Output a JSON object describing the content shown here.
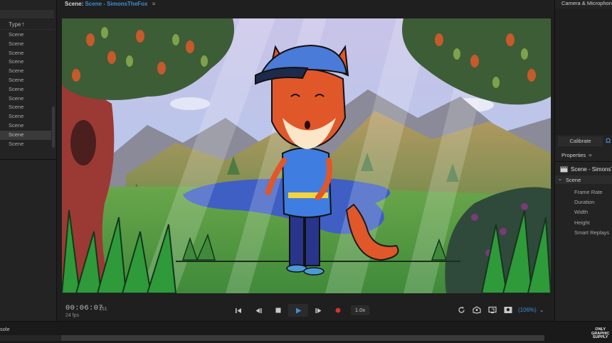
{
  "left_panel": {
    "type_header": "Type",
    "sort_icon": "sort-ascending-icon",
    "items": [
      "Scene",
      "Scene",
      "Scene",
      "Scene",
      "Scene",
      "Scene",
      "Scene",
      "Scene",
      "Scene",
      "Scene",
      "Scene",
      "Scene",
      "Scene"
    ],
    "selected_index": 11
  },
  "scene_panel": {
    "title_prefix": "Scene:",
    "scene_name": "Scene - SimonsTheFox",
    "menu_glyph": "≡",
    "timecode": "00:06:07",
    "frame": "151",
    "fps": "24 fps",
    "transport": {
      "icons": [
        "skip-to-start-icon",
        "step-back-icon",
        "stop-icon",
        "play-icon",
        "step-forward-icon",
        "record-icon"
      ]
    },
    "speed": "1.0x",
    "tools": [
      "refresh-icon",
      "fit-view-icon",
      "screen-icon",
      "scene-preview-icon"
    ],
    "zoom": "(106%)",
    "zoom_chevron": "⌄"
  },
  "right_panel": {
    "camera_title": "Camera & Microphone",
    "calibrate_label": "Calibrate",
    "calibrate_icon_glyph": "Ω",
    "properties_title": "Properties",
    "properties_menu": "≡",
    "scene_row_label": "Scene - SimonsTheFox",
    "group_label": "Scene",
    "group_chevron": "⌄",
    "properties": [
      "Frame Rate",
      "Duration",
      "Width",
      "Height",
      "Smart Replays"
    ]
  },
  "console": {
    "label": "sole"
  },
  "watermark": {
    "line1": "ONLY",
    "line2": "GRAPHIC",
    "line3": "SUPPLY"
  },
  "colors": {
    "accent": "#3d8fd8",
    "record": "#e03030",
    "panel_bg": "#232323"
  }
}
